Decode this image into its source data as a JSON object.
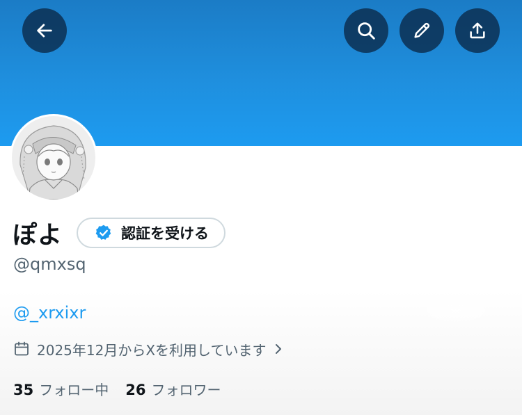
{
  "colors": {
    "banner_top": "#1b7cc6",
    "banner_bottom": "#1d9bf0",
    "button_bg": "rgba(10,40,70,0.78)",
    "accent": "#1d9bf0",
    "text_primary": "#0f1419",
    "text_secondary": "#536471"
  },
  "header": {
    "back_icon": "arrow-left-icon",
    "search_icon": "search-icon",
    "edit_icon": "pencil-icon",
    "share_icon": "share-icon"
  },
  "profile": {
    "display_name": "ぽよ",
    "verify_button_label": "認証を受ける",
    "verify_icon": "verified-badge-icon",
    "handle": "@qmxsq",
    "bio_link": "@_xrxixr",
    "joined_text": "2025年12月からXを利用しています",
    "joined_icon": "calendar-icon",
    "following_count": "35",
    "following_label": "フォロー中",
    "followers_count": "26",
    "followers_label": "フォロワー"
  }
}
